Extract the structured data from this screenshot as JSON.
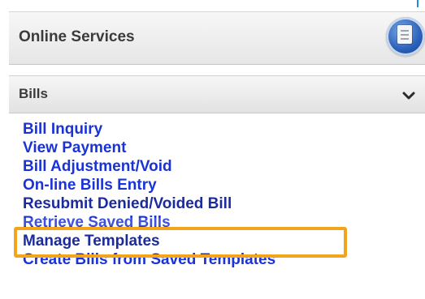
{
  "panel": {
    "title": "Online Services",
    "icon_name": "document-icon",
    "accent": "#2a60b8"
  },
  "section": {
    "label": "Bills",
    "toggle_icon": "chevron-down-icon"
  },
  "links": [
    "Bill Inquiry",
    "View Payment",
    "Bill Adjustment/Void",
    "On-line Bills Entry",
    "Resubmit Denied/Voided Bill",
    "Retrieve Saved Bills",
    "Manage Templates",
    "Create Bills from Saved Templates"
  ],
  "highlight": {
    "color": "#f2a51a",
    "target_label": "Retrieve Saved Bills"
  },
  "colors": {
    "link": "#1a33d6",
    "header_text": "#3b3b3b"
  }
}
